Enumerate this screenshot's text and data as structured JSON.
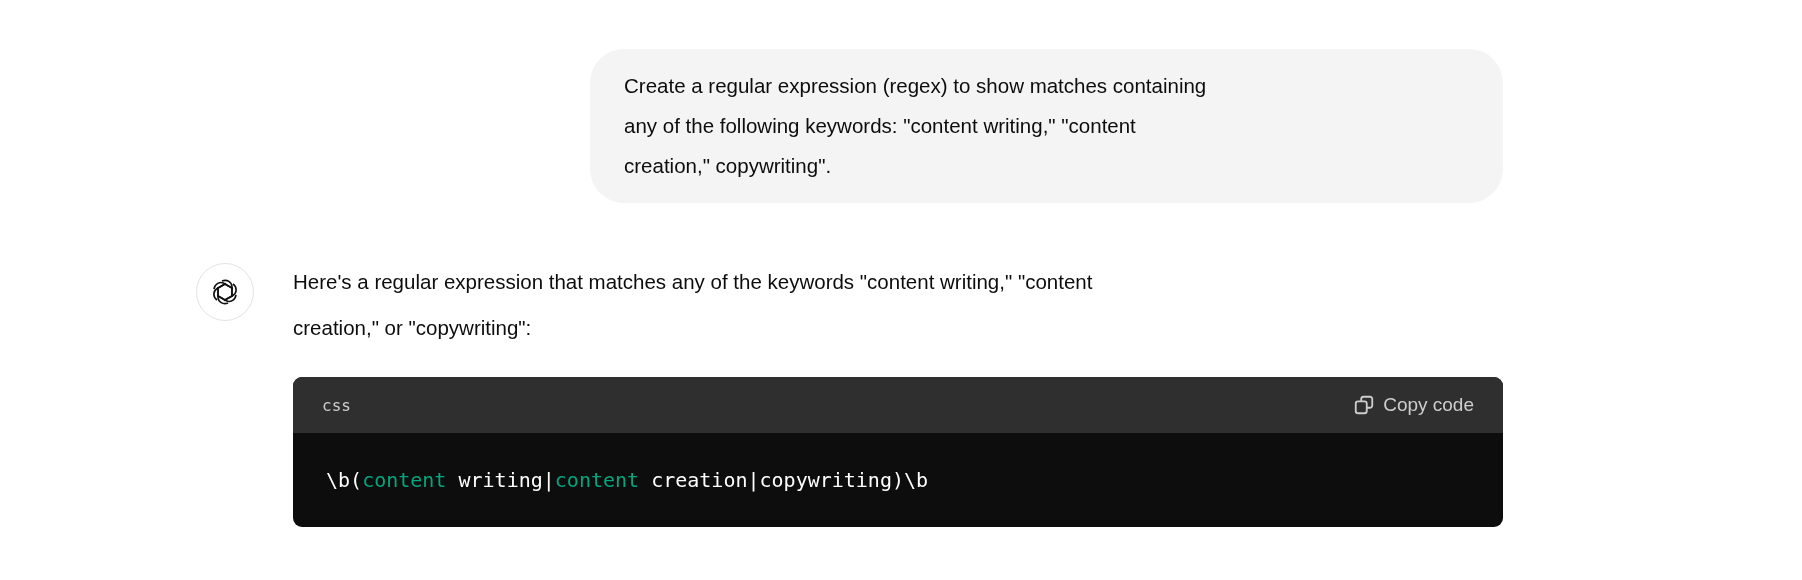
{
  "user_message": {
    "lines": [
      "Create a regular expression (regex) to show matches containing",
      "any of the following keywords: \"content writing,\" \"content",
      "creation,\" copywriting\"."
    ]
  },
  "assistant_message": {
    "lines": [
      "Here's a regular expression that matches any of the keywords \"content writing,\" \"content",
      "creation,\" or \"copywriting\":"
    ],
    "code_block": {
      "language": "css",
      "copy_button": "Copy code",
      "tokens": [
        {
          "kind": "plain",
          "text": "\\b("
        },
        {
          "kind": "keyword",
          "text": "content"
        },
        {
          "kind": "plain",
          "text": " writing|"
        },
        {
          "kind": "keyword",
          "text": "content"
        },
        {
          "kind": "plain",
          "text": " creation|copywriting)\\b"
        }
      ]
    }
  }
}
